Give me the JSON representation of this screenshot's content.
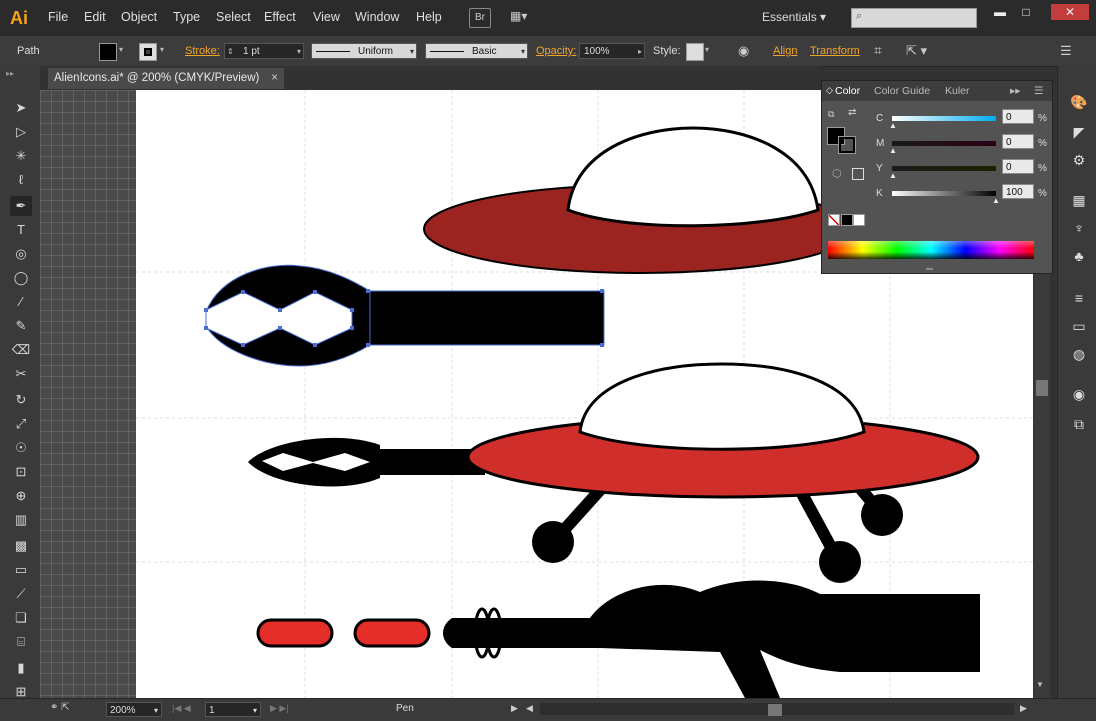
{
  "app": {
    "logo": "Ai"
  },
  "menu": [
    "File",
    "Edit",
    "Object",
    "Type",
    "Select",
    "Effect",
    "View",
    "Window",
    "Help"
  ],
  "bridge_button": "Br",
  "workspace": "Essentials",
  "search": {
    "placeholder": ""
  },
  "control": {
    "selection_type": "Path",
    "stroke_label": "Stroke:",
    "stroke_weight": "1 pt",
    "profile": "Uniform",
    "brush": "Basic",
    "opacity_label": "Opacity:",
    "opacity_value": "100%",
    "style_label": "Style:",
    "align_label": "Align",
    "transform_label": "Transform"
  },
  "document_tab": {
    "title": "AlienIcons.ai* @ 200% (CMYK/Preview)"
  },
  "color_panel": {
    "tabs": [
      "Color",
      "Color Guide",
      "Kuler"
    ],
    "channels": [
      {
        "label": "C",
        "value": "0",
        "unit": "%"
      },
      {
        "label": "M",
        "value": "0",
        "unit": "%"
      },
      {
        "label": "Y",
        "value": "0",
        "unit": "%"
      },
      {
        "label": "K",
        "value": "100",
        "unit": "%"
      }
    ]
  },
  "status": {
    "zoom": "200%",
    "artboard": "1",
    "tool": "Pen"
  },
  "colors": {
    "ufo_dark_red": "#9b2420",
    "ufo_red": "#cf2e2b",
    "pill_red": "#e52d2a",
    "selection_blue": "#4a6cd4",
    "accent_orange": "#f3a52a"
  }
}
